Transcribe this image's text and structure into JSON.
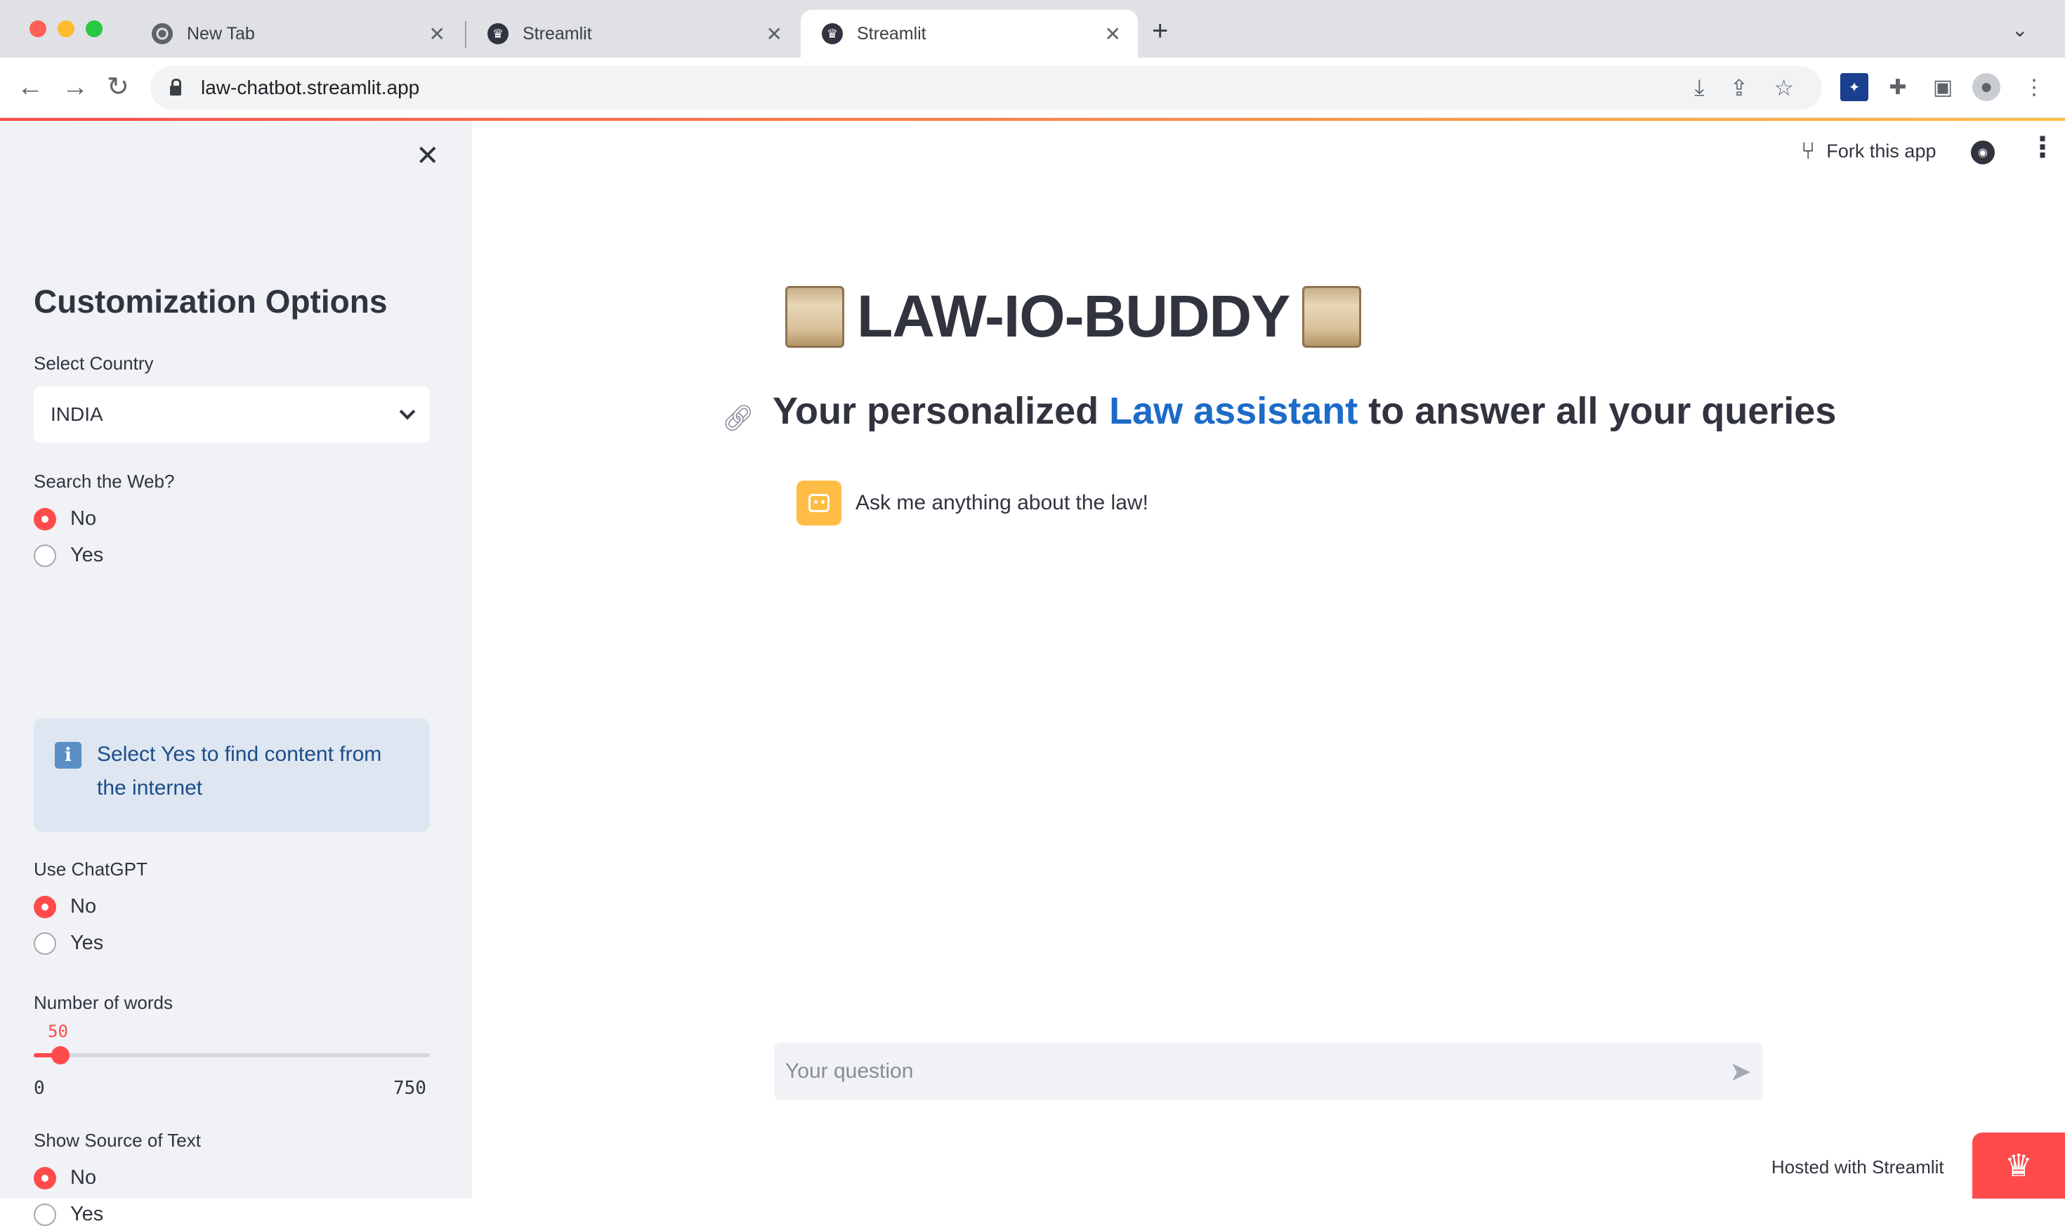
{
  "browser": {
    "tabs": [
      {
        "title": "New Tab",
        "icon": "chrome-icon"
      },
      {
        "title": "Streamlit",
        "icon": "streamlit-icon"
      },
      {
        "title": "Streamlit",
        "icon": "streamlit-icon",
        "active": true
      }
    ],
    "url": "law-chatbot.streamlit.app"
  },
  "sidebar": {
    "title": "Customization Options",
    "country": {
      "label": "Select Country",
      "value": "INDIA"
    },
    "search_web": {
      "label": "Search the Web?",
      "options": [
        "No",
        "Yes"
      ],
      "selected": "No"
    },
    "info": "Select Yes to find content from the internet",
    "use_chatgpt": {
      "label": "Use ChatGPT",
      "options": [
        "No",
        "Yes"
      ],
      "selected": "No"
    },
    "words": {
      "label": "Number of words",
      "value": "50",
      "min": "0",
      "max": "750"
    },
    "show_source": {
      "label": "Show Source of Text",
      "options": [
        "No",
        "Yes"
      ],
      "selected": "No"
    }
  },
  "header": {
    "fork_label": "Fork this app"
  },
  "main": {
    "title": "LAW-IO-BUDDY",
    "subtitle_pre": "Your personalized ",
    "subtitle_accent": "Law assistant",
    "subtitle_post": " to answer all your queries",
    "assistant_message": "Ask me anything about the law!",
    "input_placeholder": "Your question"
  },
  "footer": {
    "hosted": "Hosted with Streamlit"
  },
  "colors": {
    "accent": "#ff4b4b",
    "sidebar_bg": "#f0f2f6",
    "link_blue": "#1c6bc8",
    "info_bg": "#dee6f1"
  }
}
